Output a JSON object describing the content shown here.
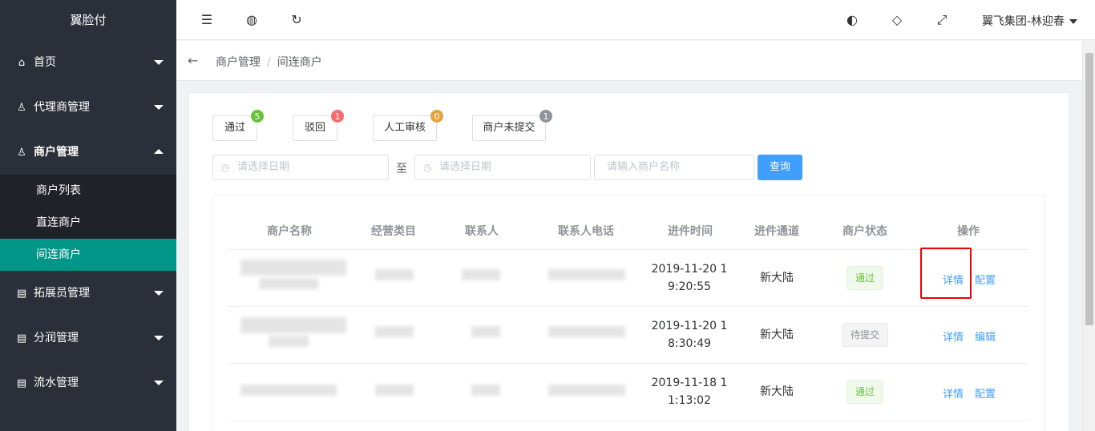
{
  "app": {
    "title": "翼脸付"
  },
  "sidebar": {
    "items": [
      {
        "label": "首页",
        "icon": "home-icon"
      },
      {
        "label": "代理商管理",
        "icon": "user-icon"
      },
      {
        "label": "商户管理",
        "icon": "user-icon",
        "open": true,
        "children": [
          "商户列表",
          "直连商户",
          "间连商户"
        ],
        "active_child": "间连商户"
      },
      {
        "label": "拓展员管理",
        "icon": "clipboard-icon"
      },
      {
        "label": "分润管理",
        "icon": "clipboard-icon"
      },
      {
        "label": "流水管理",
        "icon": "clipboard-icon"
      }
    ]
  },
  "header": {
    "icons": [
      "collapse-menu-icon",
      "globe-icon",
      "refresh-icon",
      "palette-icon",
      "tag-icon",
      "fullscreen-icon"
    ],
    "user": "翼飞集团-林迎春"
  },
  "breadcrumb": {
    "items": [
      "商户管理",
      "间连商户"
    ]
  },
  "status_buttons": [
    {
      "label": "通过",
      "count": "5",
      "color": "#67c23a"
    },
    {
      "label": "驳回",
      "count": "1",
      "color": "#f56c6c"
    },
    {
      "label": "人工审核",
      "count": "0",
      "color": "#e6a23c"
    },
    {
      "label": "商户未提交",
      "count": "1",
      "color": "#909399"
    }
  ],
  "filters": {
    "start_date_placeholder": "请选择日期",
    "to_label": "至",
    "end_date_placeholder": "请选择日期",
    "name_placeholder": "请输入商户名称",
    "search_label": "查询"
  },
  "table": {
    "columns": [
      "商户名称",
      "经营类目",
      "联系人",
      "联系人电话",
      "进件时间",
      "进件通道",
      "商户状态",
      "操作"
    ],
    "rows": [
      {
        "time_line1": "2019-11-20 1",
        "time_line2": "9:20:55",
        "channel": "新大陆",
        "status": "通过",
        "action1": "详情",
        "action2": "配置"
      },
      {
        "time_line1": "2019-11-20 1",
        "time_line2": "8:30:49",
        "channel": "新大陆",
        "status": "待提交",
        "action1": "详情",
        "action2": "编辑"
      },
      {
        "time_line1": "2019-11-18 1",
        "time_line2": "1:13:02",
        "channel": "新大陆",
        "status": "通过",
        "action1": "详情",
        "action2": "配置"
      }
    ]
  }
}
